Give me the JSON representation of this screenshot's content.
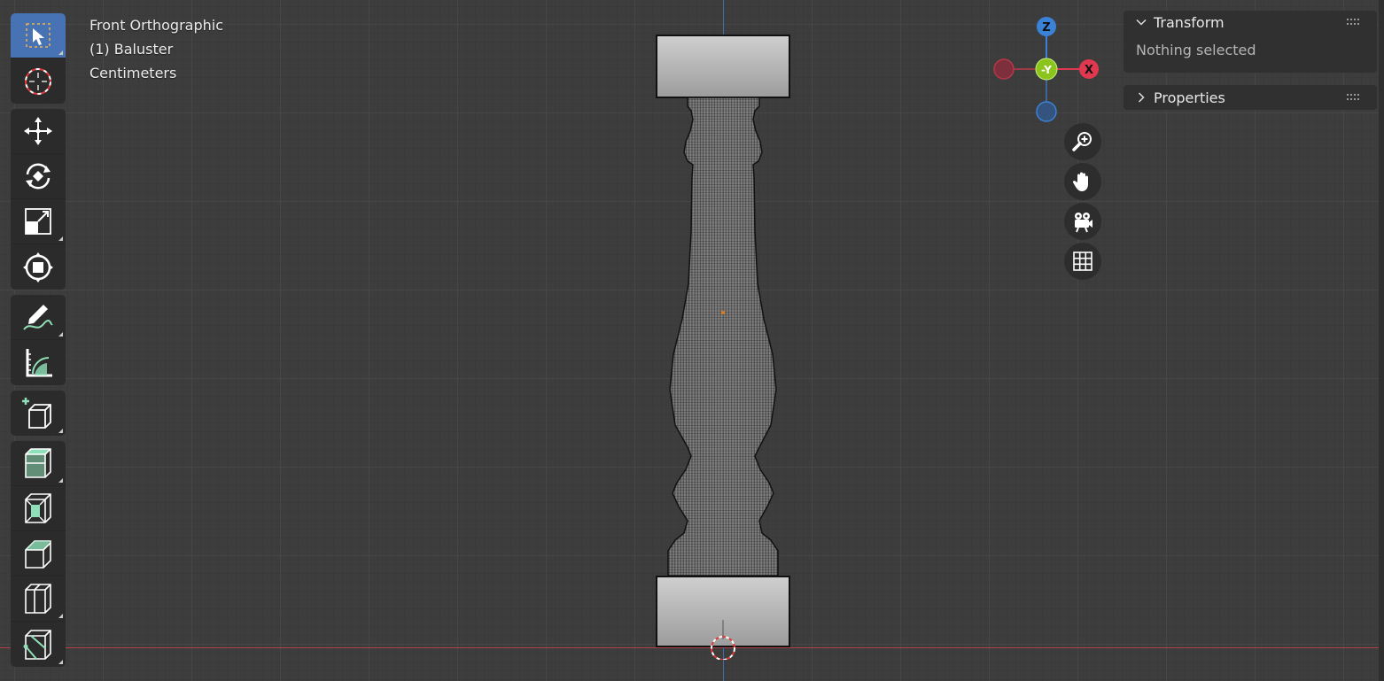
{
  "viewport": {
    "view_name": "Front Orthographic",
    "object_label": "(1) Baluster",
    "units": "Centimeters"
  },
  "gizmo": {
    "z_label": "Z",
    "y_label": "-Y",
    "x_label": "X",
    "colors": {
      "x": "#e0394f",
      "y": "#8ac41c",
      "z": "#3a82d8"
    }
  },
  "nav_buttons": [
    "zoom-icon",
    "hand-pan-icon",
    "camera-icon",
    "grid-icon"
  ],
  "toolbar": {
    "tools": [
      "select-box",
      "cursor",
      "move",
      "rotate",
      "scale",
      "transform",
      "annotate",
      "measure",
      "add-cube",
      "extrude-region",
      "inset-faces",
      "bevel",
      "loop-cut",
      "knife"
    ]
  },
  "sidebar": {
    "transform_title": "Transform",
    "transform_body": "Nothing selected",
    "properties_title": "Properties"
  },
  "colors": {
    "accent": "#4772b3",
    "x_axis_line": "#b34048",
    "z_axis_line": "#3f6fb0"
  }
}
